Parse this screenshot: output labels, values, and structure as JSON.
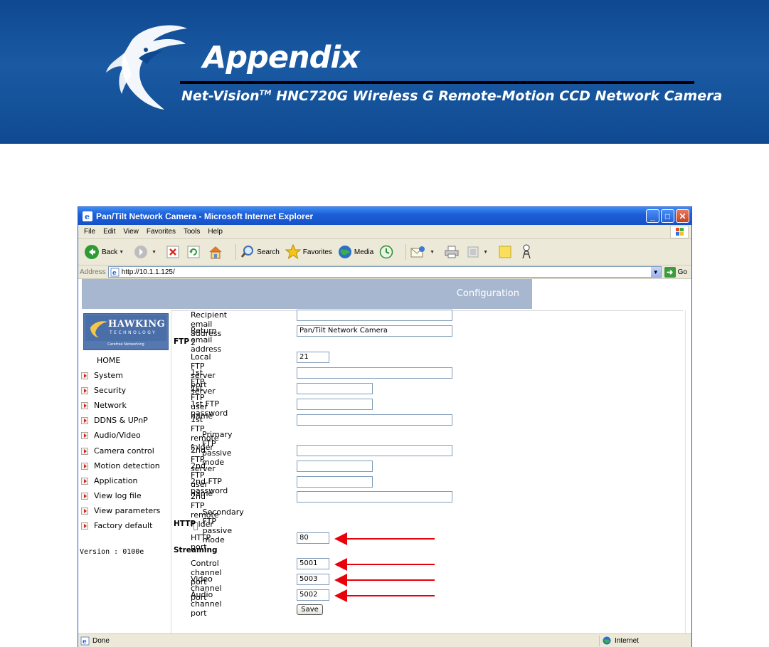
{
  "banner": {
    "title": "Appendix",
    "subtitle_prefix": "Net-Vision",
    "subtitle_tm": "TM",
    "subtitle_rest": " HNC720G Wireless G Remote-Motion CCD Network Camera"
  },
  "window": {
    "title": "Pan/Tilt Network Camera - Microsoft Internet Explorer",
    "menu": [
      "File",
      "Edit",
      "View",
      "Favorites",
      "Tools",
      "Help"
    ],
    "toolbar": {
      "back": "Back",
      "search": "Search",
      "favorites": "Favorites",
      "media": "Media"
    },
    "address_label": "Address",
    "address_url": "http://10.1.1.125/",
    "go_label": "Go",
    "status_text": "Done",
    "status_zone": "Internet"
  },
  "page": {
    "header_label": "Configuration",
    "brand": {
      "name": "HAWKING",
      "sub": "TECHNOLOGY",
      "tagline": "Carefree Networking"
    },
    "nav_home": "HOME",
    "nav_items": [
      "System",
      "Security",
      "Network",
      "DDNS & UPnP",
      "Audio/Video",
      "Camera control",
      "Motion detection",
      "Application",
      "View log file",
      "View parameters",
      "Factory default"
    ],
    "version": "Version : 0100e",
    "form": {
      "recipient_email_2": {
        "label": "Recipient email address 2",
        "value": ""
      },
      "return_email": {
        "label": "Return email address",
        "value": "Pan/Tilt Network Camera"
      },
      "ftp_section": "FTP",
      "local_ftp_port": {
        "label": "Local FTP server port",
        "value": "21"
      },
      "ftp1_server": {
        "label": "1st FTP server",
        "value": ""
      },
      "ftp1_user": {
        "label": "1st FTP user name",
        "value": ""
      },
      "ftp1_password": {
        "label": "1st FTP password",
        "value": ""
      },
      "ftp1_folder": {
        "label": "1st FTP remote folder",
        "value": ""
      },
      "primary_passive": "Primary FTP passive mode",
      "ftp2_server": {
        "label": "2nd FTP server",
        "value": ""
      },
      "ftp2_user": {
        "label": "2nd FTP user name",
        "value": ""
      },
      "ftp2_password": {
        "label": "2nd FTP password",
        "value": ""
      },
      "ftp2_folder": {
        "label": "2nd FTP remote folder",
        "value": ""
      },
      "secondary_passive": "Secondary FTP passive mode",
      "http_section": "HTTP",
      "http_port": {
        "label": "HTTP port",
        "value": "80"
      },
      "streaming_section": "Streaming",
      "control_port": {
        "label": "Control channel port",
        "value": "5001"
      },
      "video_port": {
        "label": "Video channel port",
        "value": "5003"
      },
      "audio_port": {
        "label": "Audio channel port",
        "value": "5002"
      },
      "save_label": "Save"
    }
  },
  "colors": {
    "banner_blue": "#114b8f",
    "config_bar": "#a8b7d0",
    "annotation_red": "#e8000b"
  }
}
